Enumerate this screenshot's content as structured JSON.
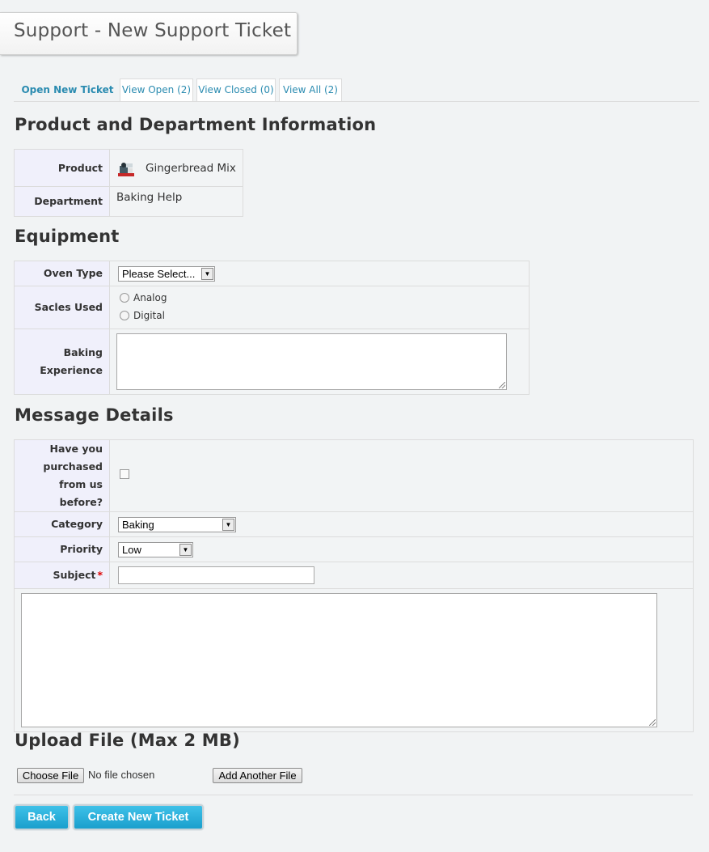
{
  "page": {
    "title": "Support - New Support Ticket"
  },
  "tabs": [
    {
      "label": "Open New Ticket",
      "active": true
    },
    {
      "label": "View Open (2)",
      "active": false
    },
    {
      "label": "View Closed (0)",
      "active": false
    },
    {
      "label": "View All (2)",
      "active": false
    }
  ],
  "product_section": {
    "heading": "Product and Department Information",
    "product_label": "Product",
    "product_value": "Gingerbread Mix",
    "department_label": "Department",
    "department_value": "Baking Help"
  },
  "equipment": {
    "heading": "Equipment",
    "oven_label": "Oven Type",
    "oven_selected": "Please Select...",
    "scales_label": "Sacles Used",
    "scales_options": [
      "Analog",
      "Digital"
    ],
    "experience_label": "Baking Experience"
  },
  "message": {
    "heading": "Message Details",
    "purchased_label": "Have you purchased from us before?",
    "category_label": "Category",
    "category_selected": "Baking",
    "priority_label": "Priority",
    "priority_selected": "Low",
    "subject_label": "Subject",
    "required_mark": "*"
  },
  "upload": {
    "heading": "Upload File (Max 2 MB)",
    "choose_label": "Choose File",
    "no_file_text": "No file chosen",
    "add_another_label": "Add Another File"
  },
  "actions": {
    "back_label": "Back",
    "create_label": "Create New Ticket"
  },
  "colors": {
    "accent": "#2a8bb0",
    "button_blue": "#1a9fcd",
    "label_bg": "#f0f0fb"
  }
}
